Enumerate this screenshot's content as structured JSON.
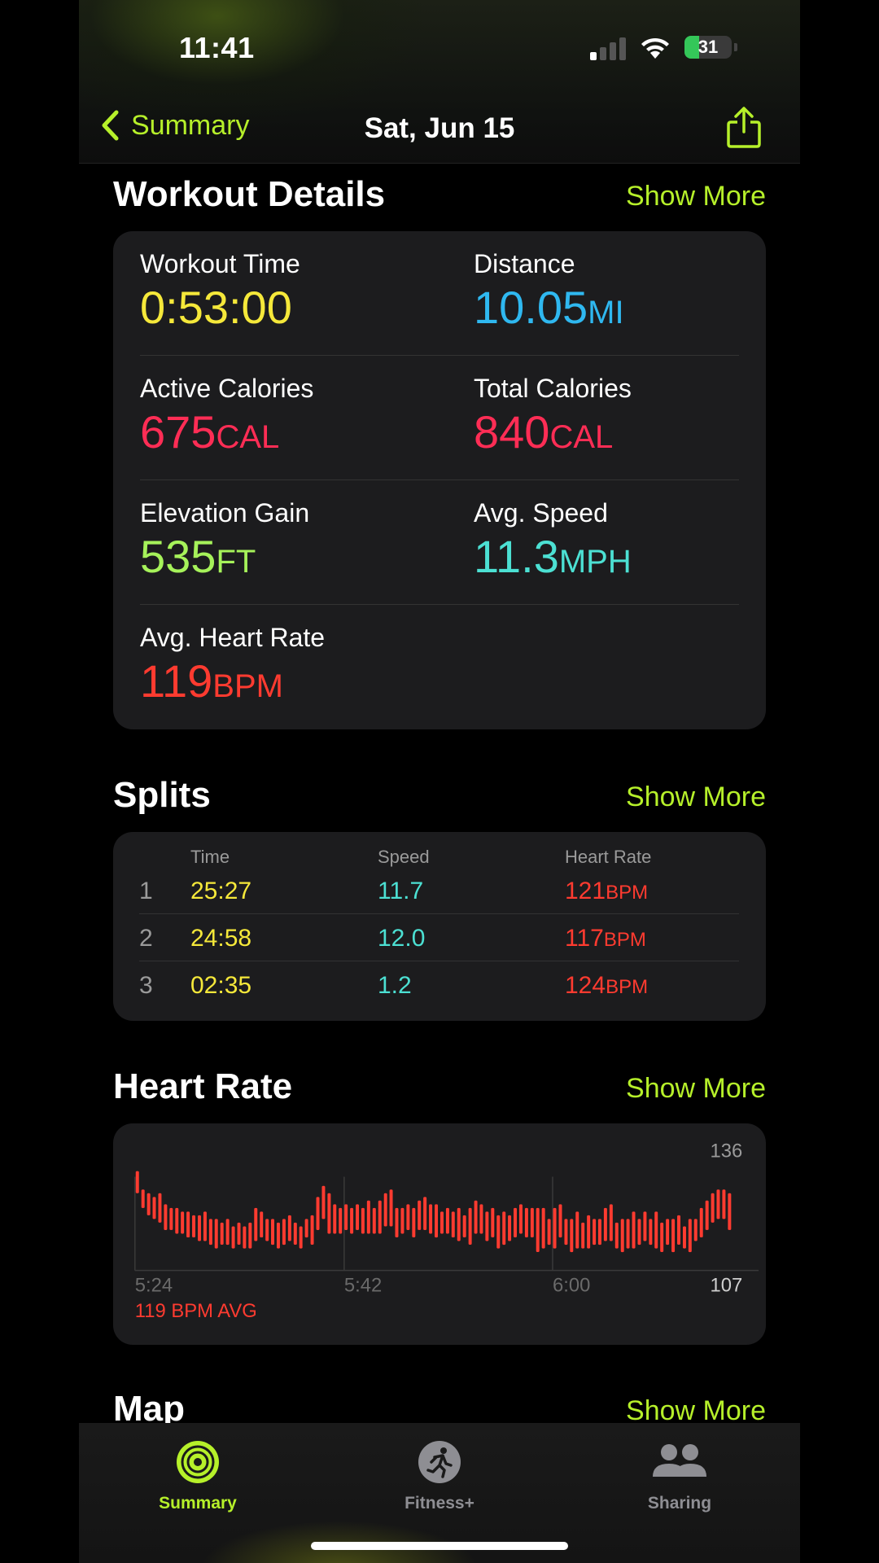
{
  "status_bar": {
    "time": "11:41",
    "battery": "31",
    "battery_level": 0.31
  },
  "nav": {
    "back_label": "Summary",
    "title": "Sat, Jun 15"
  },
  "workout_details": {
    "title": "Workout Details",
    "show_more": "Show More",
    "metrics": [
      {
        "label": "Workout Time",
        "value": "0:53:00",
        "unit": "",
        "color": "#f5e83a"
      },
      {
        "label": "Distance",
        "value": "10.05",
        "unit": "MI",
        "color": "#2fb8f0"
      },
      {
        "label": "Active Calories",
        "value": "675",
        "unit": "CAL",
        "color": "#ff2d55"
      },
      {
        "label": "Total Calories",
        "value": "840",
        "unit": "CAL",
        "color": "#ff2d55"
      },
      {
        "label": "Elevation Gain",
        "value": "535",
        "unit": "FT",
        "color": "#a6f25a"
      },
      {
        "label": "Avg. Speed",
        "value": "11.3",
        "unit": "MPH",
        "color": "#4ce0d3"
      },
      {
        "label": "Avg. Heart Rate",
        "value": "119",
        "unit": "BPM",
        "color": "#ff3b30"
      }
    ]
  },
  "splits": {
    "title": "Splits",
    "show_more": "Show More",
    "headers": [
      "Time",
      "Speed",
      "Heart Rate"
    ],
    "rows": [
      {
        "index": "1",
        "time": "25:27",
        "speed": "11.7",
        "hr": "121",
        "hr_unit": "BPM"
      },
      {
        "index": "2",
        "time": "24:58",
        "speed": "12.0",
        "hr": "117",
        "hr_unit": "BPM"
      },
      {
        "index": "3",
        "time": "02:35",
        "speed": "1.2",
        "hr": "124",
        "hr_unit": "BPM"
      }
    ]
  },
  "heart_rate": {
    "title": "Heart Rate",
    "show_more": "Show More",
    "avg_label": "119 BPM AVG"
  },
  "map": {
    "title": "Map",
    "show_more": "Show More"
  },
  "tabs": [
    {
      "label": "Summary",
      "icon": "activity-rings-icon",
      "active": true
    },
    {
      "label": "Fitness+",
      "icon": "fitness-plus-icon",
      "active": false
    },
    {
      "label": "Sharing",
      "icon": "sharing-people-icon",
      "active": false
    }
  ],
  "colors": {
    "accent": "#b6f02a",
    "heart": "#ff3b30"
  },
  "chart_data": {
    "type": "bar",
    "title": "",
    "y_max_label": "136",
    "y_min_label": "107",
    "ylim": [
      107,
      136
    ],
    "x_tick_labels": [
      "5:24",
      "5:42",
      "6:00"
    ],
    "series": [
      {
        "values": [
          [
            128,
            134
          ],
          [
            124,
            129
          ],
          [
            122,
            128
          ],
          [
            121,
            127
          ],
          [
            120,
            128
          ],
          [
            118,
            125
          ],
          [
            118,
            124
          ],
          [
            117,
            124
          ],
          [
            117,
            123
          ],
          [
            116,
            123
          ],
          [
            116,
            122
          ],
          [
            115,
            122
          ],
          [
            115,
            123
          ],
          [
            114,
            121
          ],
          [
            113,
            121
          ],
          [
            114,
            120
          ],
          [
            114,
            121
          ],
          [
            113,
            119
          ],
          [
            114,
            120
          ],
          [
            113,
            119
          ],
          [
            113,
            120
          ],
          [
            115,
            124
          ],
          [
            116,
            123
          ],
          [
            115,
            121
          ],
          [
            114,
            121
          ],
          [
            113,
            120
          ],
          [
            114,
            121
          ],
          [
            115,
            122
          ],
          [
            114,
            120
          ],
          [
            113,
            119
          ],
          [
            116,
            121
          ],
          [
            114,
            122
          ],
          [
            118,
            127
          ],
          [
            121,
            130
          ],
          [
            117,
            128
          ],
          [
            117,
            125
          ],
          [
            117,
            124
          ],
          [
            118,
            125
          ],
          [
            117,
            124
          ],
          [
            118,
            125
          ],
          [
            117,
            124
          ],
          [
            117,
            126
          ],
          [
            117,
            124
          ],
          [
            117,
            126
          ],
          [
            119,
            128
          ],
          [
            119,
            129
          ],
          [
            116,
            124
          ],
          [
            117,
            124
          ],
          [
            118,
            125
          ],
          [
            116,
            124
          ],
          [
            118,
            126
          ],
          [
            118,
            127
          ],
          [
            117,
            125
          ],
          [
            116,
            125
          ],
          [
            117,
            123
          ],
          [
            117,
            124
          ],
          [
            116,
            123
          ],
          [
            115,
            124
          ],
          [
            116,
            122
          ],
          [
            114,
            124
          ],
          [
            117,
            126
          ],
          [
            117,
            125
          ],
          [
            115,
            123
          ],
          [
            116,
            124
          ],
          [
            113,
            122
          ],
          [
            114,
            123
          ],
          [
            115,
            122
          ],
          [
            116,
            124
          ],
          [
            117,
            125
          ],
          [
            116,
            124
          ],
          [
            116,
            124
          ],
          [
            112,
            124
          ],
          [
            113,
            124
          ],
          [
            114,
            121
          ],
          [
            113,
            124
          ],
          [
            116,
            125
          ],
          [
            114,
            121
          ],
          [
            112,
            121
          ],
          [
            113,
            123
          ],
          [
            113,
            120
          ],
          [
            113,
            122
          ],
          [
            114,
            121
          ],
          [
            114,
            121
          ],
          [
            115,
            124
          ],
          [
            115,
            125
          ],
          [
            113,
            120
          ],
          [
            112,
            121
          ],
          [
            113,
            121
          ],
          [
            113,
            123
          ],
          [
            114,
            121
          ],
          [
            115,
            123
          ],
          [
            114,
            121
          ],
          [
            113,
            123
          ],
          [
            112,
            120
          ],
          [
            114,
            121
          ],
          [
            112,
            121
          ],
          [
            114,
            122
          ],
          [
            113,
            119
          ],
          [
            112,
            121
          ],
          [
            115,
            121
          ],
          [
            116,
            124
          ],
          [
            118,
            126
          ],
          [
            120,
            128
          ],
          [
            121,
            129
          ],
          [
            121,
            129
          ],
          [
            118,
            128
          ]
        ]
      }
    ]
  }
}
